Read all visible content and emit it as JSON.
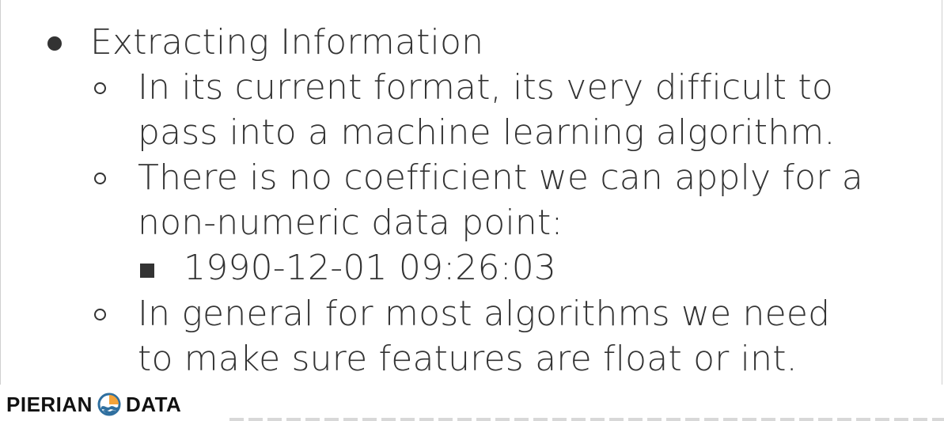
{
  "slide": {
    "heading": "Extracting Information",
    "sub_points": [
      {
        "lines": [
          "In its current format, its very difficult to",
          "pass into a machine learning algorithm."
        ]
      },
      {
        "lines": [
          "There is no coefficient we can apply for a",
          "non-numeric data point:"
        ],
        "example": "1990-12-01 09:26:03"
      },
      {
        "lines": [
          "In general for most algorithms we need",
          "to make sure features are float or int."
        ]
      }
    ]
  },
  "logo": {
    "left_text": "PIERIAN",
    "right_text": "DATA",
    "icon": "pierian-data-logo-mark",
    "colors": {
      "orange": "#f3a33a",
      "blue": "#2f6f9f",
      "dark": "#111111"
    }
  }
}
